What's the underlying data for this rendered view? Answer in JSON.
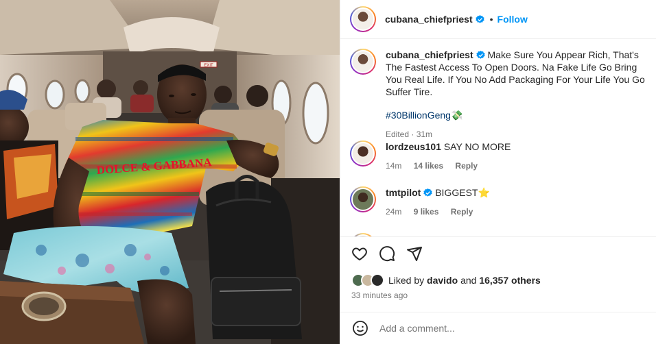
{
  "post": {
    "username": "cubana_chiefpriest",
    "follow_label": "Follow",
    "dot": "•",
    "caption": "Make Sure You Appear Rich, That's The Fastest Access To Open Doors. Na Fake Life Go Bring You Real Life. If You No Add Packaging For Your Life You Go Suffer Tire.",
    "hashtag": "#30BillionGeng",
    "hashtag_emoji": "💸",
    "caption_meta": "Edited · 31m"
  },
  "comments": [
    {
      "username": "lordzeus101",
      "text": "SAY NO MORE",
      "time": "14m",
      "likes": "14 likes",
      "reply": "Reply"
    },
    {
      "username": "tmtpilot",
      "text": "BIGGEST",
      "emoji": "⭐",
      "time": "24m",
      "likes": "9 likes",
      "reply": "Reply"
    }
  ],
  "likes": {
    "prefix": "Liked by",
    "user": "davido",
    "middle": "and",
    "count": "16,357 others"
  },
  "time_ago": "33 minutes ago",
  "add_comment": {
    "placeholder": "Add a comment..."
  },
  "photo": {
    "exit_sign": "EXIT",
    "shirt_text": "DOLCE & GABBANA"
  },
  "colors": {
    "link": "#0095f6",
    "hashtag": "#00376b",
    "secondary": "#737373",
    "verified": "#0095f6"
  },
  "icons": [
    "heart-icon",
    "comment-icon",
    "share-icon",
    "emoji-icon",
    "verified-badge-icon"
  ]
}
